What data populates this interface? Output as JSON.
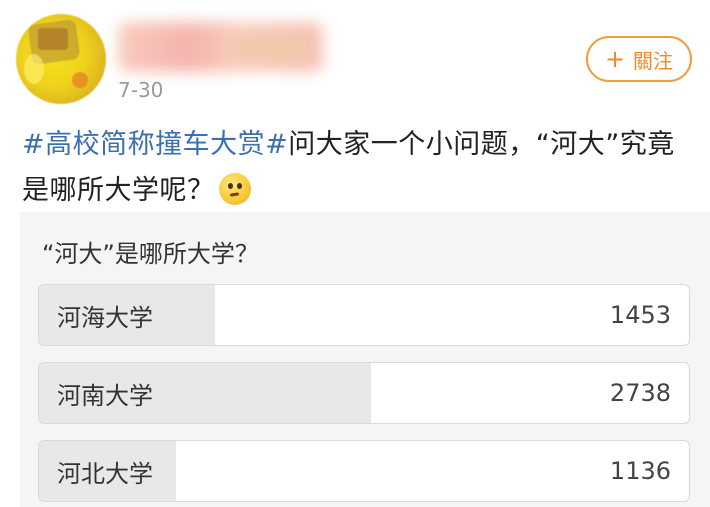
{
  "post": {
    "date": "7-30",
    "follow_label": "關注",
    "follow_icon": "plus-icon",
    "hashtag": "#高校简称撞车大赏#",
    "text_line1": "问大家一个小问题，“河大”究竟",
    "text_line2": "是哪所大学呢？",
    "emoji": "thinking-face-emoji"
  },
  "poll": {
    "question": "“河大”是哪所大学？",
    "options": [
      {
        "label": "河海大学",
        "count": "1453",
        "fill": 0.27
      },
      {
        "label": "河南大学",
        "count": "2738",
        "fill": 0.51
      },
      {
        "label": "河北大学",
        "count": "1136",
        "fill": 0.21
      }
    ]
  },
  "colors": {
    "hashtag": "#3b6fb0",
    "follow_accent": "#f08a26",
    "poll_background": "#f5f5f5",
    "option_fill": "#e8e8e8"
  }
}
